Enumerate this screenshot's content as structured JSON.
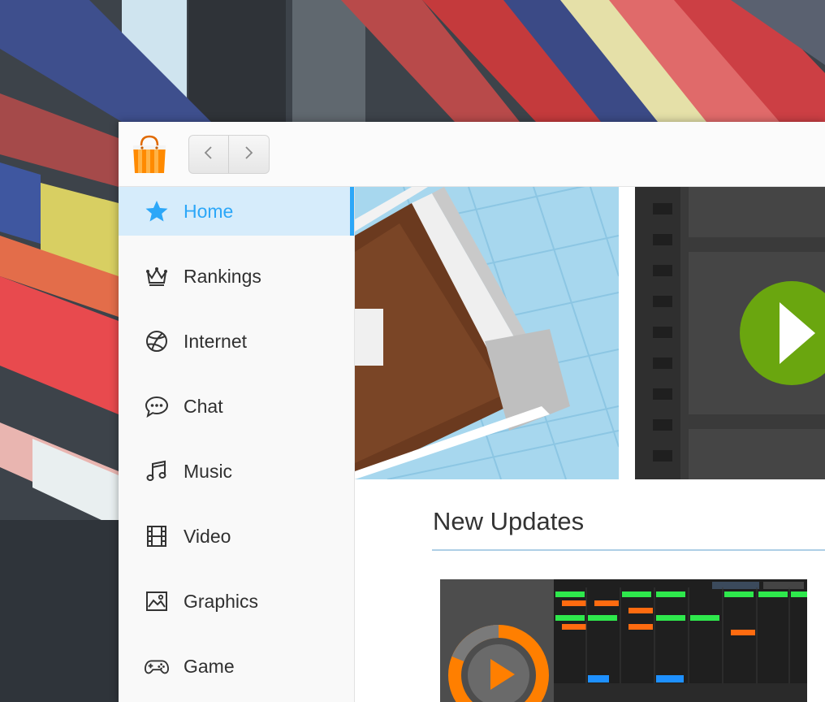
{
  "window": {
    "nav": {
      "back_icon": "chevron-left-icon",
      "forward_icon": "chevron-right-icon"
    },
    "app_icon": "shopping-bag-icon"
  },
  "sidebar": {
    "items": [
      {
        "label": "Home",
        "icon": "star-icon",
        "active": true
      },
      {
        "label": "Rankings",
        "icon": "crown-icon",
        "active": false
      },
      {
        "label": "Internet",
        "icon": "globe-icon",
        "active": false
      },
      {
        "label": "Chat",
        "icon": "chat-bubble-icon",
        "active": false
      },
      {
        "label": "Music",
        "icon": "music-note-icon",
        "active": false
      },
      {
        "label": "Video",
        "icon": "film-icon",
        "active": false
      },
      {
        "label": "Graphics",
        "icon": "image-icon",
        "active": false
      },
      {
        "label": "Game",
        "icon": "gamepad-icon",
        "active": false
      }
    ]
  },
  "main": {
    "section_title": "New Updates"
  },
  "colors": {
    "accent": "#2ca7f8",
    "active_bg": "#d6ecfb",
    "play_green": "#6aa60f",
    "card_orange": "#ff7f00"
  }
}
